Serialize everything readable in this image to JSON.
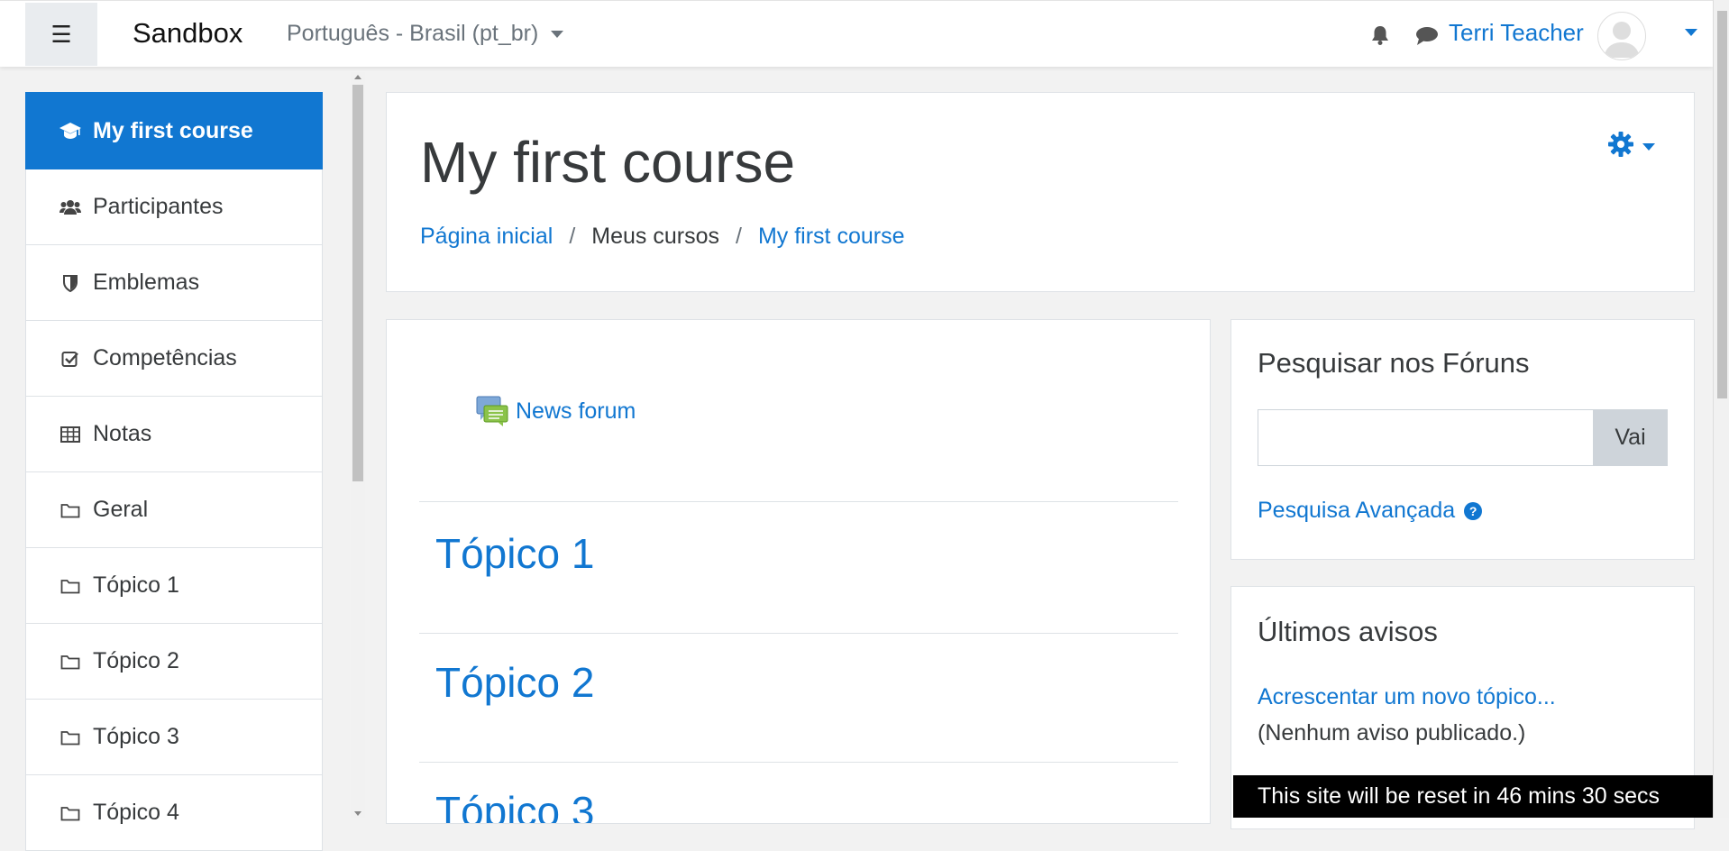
{
  "navbar": {
    "brand": "Sandbox",
    "language": "Português - Brasil (pt_br)",
    "user_name": "Terri Teacher"
  },
  "drawer": {
    "items": [
      {
        "label": "My first course",
        "icon": "graduation-cap-icon"
      },
      {
        "label": "Participantes",
        "icon": "users-icon"
      },
      {
        "label": "Emblemas",
        "icon": "shield-icon"
      },
      {
        "label": "Competências",
        "icon": "checkbox-icon"
      },
      {
        "label": "Notas",
        "icon": "table-icon"
      },
      {
        "label": "Geral",
        "icon": "folder-icon"
      },
      {
        "label": "Tópico 1",
        "icon": "folder-icon"
      },
      {
        "label": "Tópico 2",
        "icon": "folder-icon"
      },
      {
        "label": "Tópico 3",
        "icon": "folder-icon"
      },
      {
        "label": "Tópico 4",
        "icon": "folder-icon"
      }
    ]
  },
  "header": {
    "title": "My first course",
    "breadcrumb": [
      "Página inicial",
      "Meus cursos",
      "My first course"
    ]
  },
  "course": {
    "news_forum": "News forum",
    "topics": [
      "Tópico 1",
      "Tópico 2",
      "Tópico 3"
    ]
  },
  "search_block": {
    "title": "Pesquisar nos Fóruns",
    "input_value": "",
    "button_label": "Vai",
    "advanced_link": "Pesquisa Avançada"
  },
  "news_block": {
    "title": "Últimos avisos",
    "add_link": "Acrescentar um novo tópico...",
    "empty_text": "(Nenhum aviso publicado.)"
  },
  "banner": {
    "text": "This site will be reset in 46 mins 30 secs"
  },
  "colors": {
    "accent": "#1177d1",
    "background": "#f2f2f2"
  }
}
